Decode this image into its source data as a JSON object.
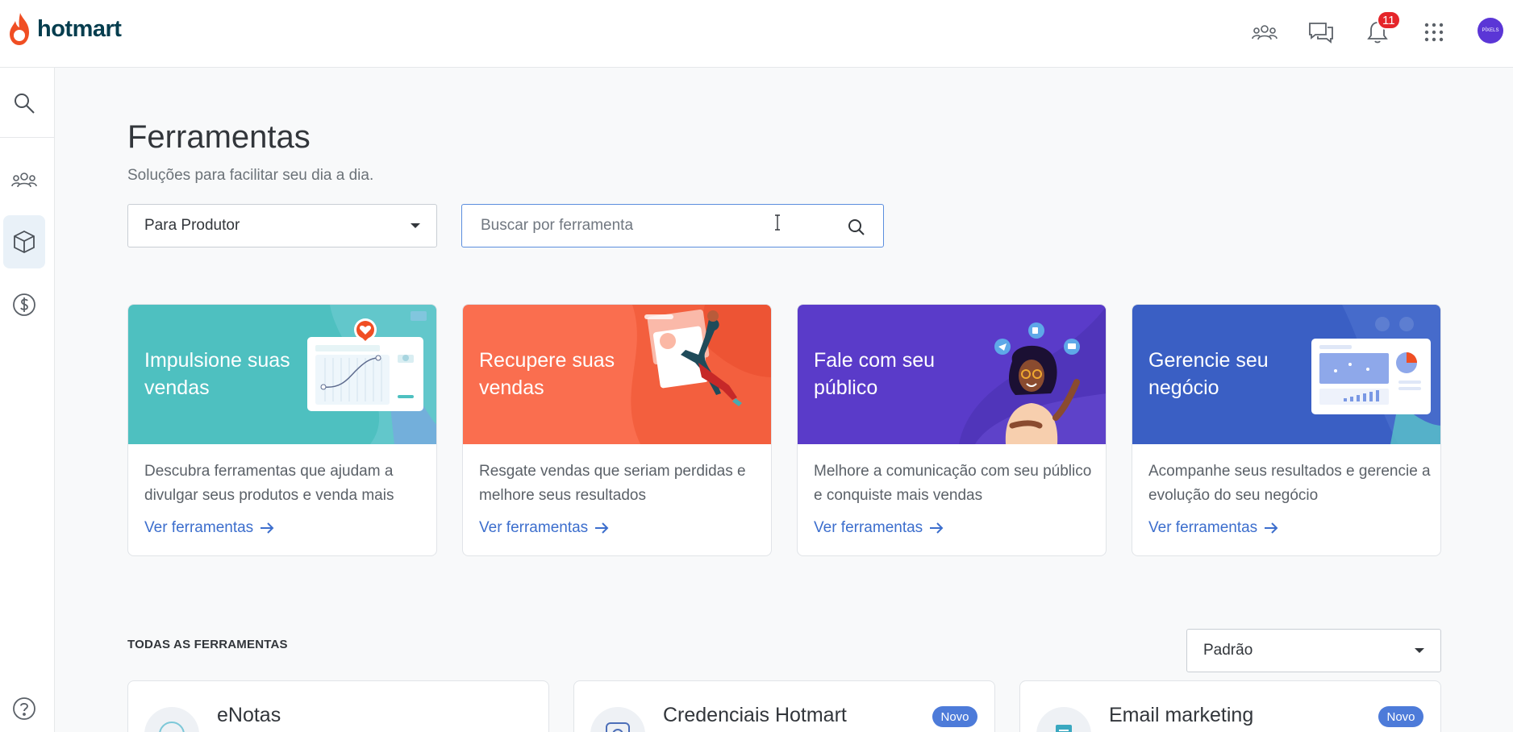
{
  "brand": {
    "name": "hotmart"
  },
  "header": {
    "notification_count": "11",
    "avatar_label": "PÍXELS"
  },
  "page": {
    "title": "Ferramentas",
    "subtitle": "Soluções para facilitar seu dia a dia."
  },
  "filters": {
    "audience_selected": "Para Produtor",
    "search_placeholder": "Buscar por ferramenta"
  },
  "categories": [
    {
      "title": "Impulsione suas vendas",
      "description": "Descubra ferramentas que ajudam a divulgar seus produtos e venda mais",
      "link": "Ver ferramentas",
      "color": "#4ec0c0"
    },
    {
      "title": "Recupere suas vendas",
      "description": "Resgate vendas que seriam perdidas e melhore seus resultados",
      "link": "Ver ferramentas",
      "color": "#fa6e4f"
    },
    {
      "title": "Fale com seu público",
      "description": "Melhore a comunicação com seu público e conquiste mais vendas",
      "link": "Ver ferramentas",
      "color": "#5a3bc9"
    },
    {
      "title": "Gerencie seu negócio",
      "description": "Acompanhe seus resultados e gerencie a evolução do seu negócio",
      "link": "Ver ferramentas",
      "color": "#3a5fc4"
    }
  ],
  "all_tools": {
    "section_label": "TODAS AS FERRAMENTAS",
    "sort_selected": "Padrão",
    "items": [
      {
        "name": "eNotas",
        "tag": ""
      },
      {
        "name": "Credenciais Hotmart",
        "tag": "Novo"
      },
      {
        "name": "Email marketing",
        "tag": "Novo"
      }
    ]
  },
  "colors": {
    "brand_flame": "#f04e23",
    "brand_text": "#053d4e",
    "link": "#3c6ecd",
    "badge": "#e5252a",
    "tag_new": "#4d7bd9"
  }
}
